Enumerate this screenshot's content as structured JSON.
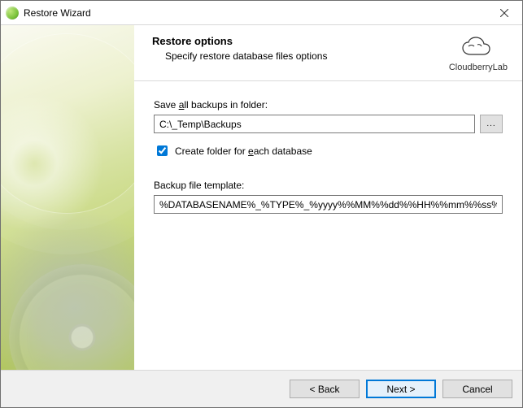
{
  "window": {
    "title": "Restore Wizard"
  },
  "header": {
    "title": "Restore options",
    "subtitle": "Specify restore database files options",
    "brand": "CloudberryLab"
  },
  "form": {
    "save_label_pre": "Save ",
    "save_label_hot": "a",
    "save_label_post": "ll backups in folder:",
    "save_path": "C:\\_Temp\\Backups",
    "browse_label": "...",
    "create_folder_checked": true,
    "create_label_pre": "Create folder for ",
    "create_label_hot": "e",
    "create_label_post": "ach database",
    "template_label": "Backup file template:",
    "template_value": "%DATABASENAME%_%TYPE%_%yyyy%%MM%%dd%%HH%%mm%%ss%.bak"
  },
  "footer": {
    "back": "< Back",
    "next": "Next >",
    "cancel": "Cancel"
  }
}
